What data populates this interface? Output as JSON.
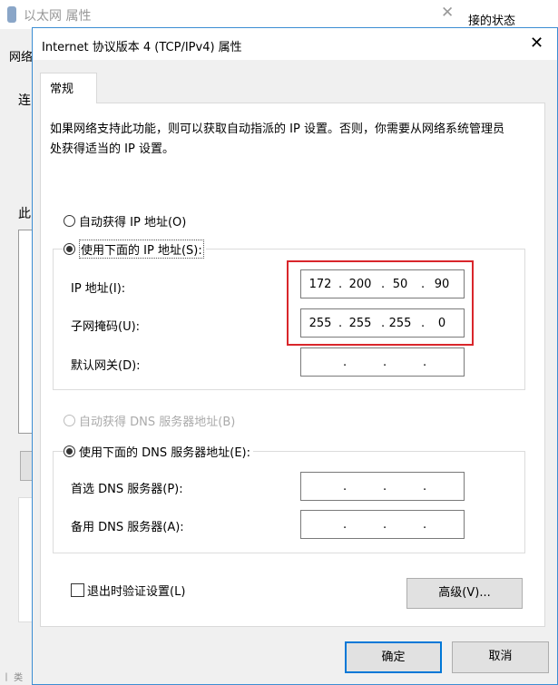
{
  "background_window": {
    "title": "以太网 属性",
    "right_title_fragment": "接的状态",
    "fragments": [
      "网络",
      "连",
      "此"
    ],
    "bottom_fragment": "丨 类"
  },
  "dialog": {
    "title": "Internet 协议版本 4 (TCP/IPv4) 属性",
    "tab": "常规",
    "description": "如果网络支持此功能，则可以获取自动指派的 IP 设置。否则，你需要从网络系统管理员处获得适当的 IP 设置。",
    "ip_auto_label": "自动获得 IP 地址(O)",
    "ip_manual_label": "使用下面的 IP 地址(S):",
    "ip_mode": "manual",
    "fields": {
      "ip": {
        "label": "IP 地址(I):",
        "value": [
          "172",
          "200",
          "50",
          "90"
        ]
      },
      "mask": {
        "label": "子网掩码(U):",
        "value": [
          "255",
          "255",
          "255",
          "0"
        ]
      },
      "gateway": {
        "label": "默认网关(D):",
        "value": [
          "",
          "",
          "",
          ""
        ]
      }
    },
    "dns_auto_label": "自动获得 DNS 服务器地址(B)",
    "dns_manual_label": "使用下面的 DNS 服务器地址(E):",
    "dns_mode": "manual",
    "dns": {
      "preferred": {
        "label": "首选 DNS 服务器(P):",
        "value": [
          "",
          "",
          "",
          ""
        ]
      },
      "alternate": {
        "label": "备用 DNS 服务器(A):",
        "value": [
          "",
          "",
          "",
          ""
        ]
      }
    },
    "validate_label": "退出时验证设置(L)",
    "validate_checked": false,
    "advanced_label": "高级(V)...",
    "ok_label": "确定",
    "cancel_label": "取消"
  },
  "colors": {
    "highlight_box": "#d9262b",
    "accent": "#0078d7"
  }
}
